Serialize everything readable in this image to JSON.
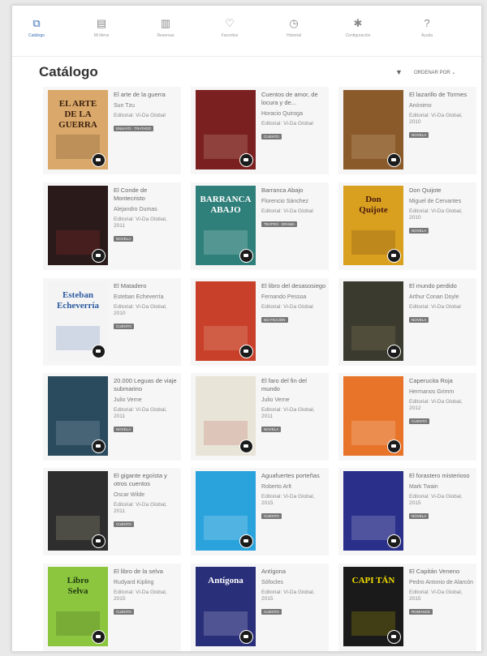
{
  "nav": [
    {
      "label": "Catálogo",
      "icon": "catalog-icon",
      "glyph": "⧉",
      "active": true
    },
    {
      "label": "Mi libros",
      "icon": "book-icon",
      "glyph": "▤",
      "active": false
    },
    {
      "label": "Reservas",
      "icon": "reservations-icon",
      "glyph": "▥",
      "active": false
    },
    {
      "label": "Favoritos",
      "icon": "heart-icon",
      "glyph": "♡",
      "active": false
    },
    {
      "label": "Historial",
      "icon": "history-icon",
      "glyph": "◷",
      "active": false
    },
    {
      "label": "Configuración",
      "icon": "gear-icon",
      "glyph": "✱",
      "active": false
    },
    {
      "label": "Ayuda",
      "icon": "help-icon",
      "glyph": "?",
      "active": false
    }
  ],
  "page": {
    "title": "Catálogo",
    "filter_icon": "filter-icon",
    "filter_glyph": "▼",
    "sort_label": "ORDENAR POR ⌄"
  },
  "books": [
    {
      "title": "El arte de la guerra",
      "author": "Sun Tzu",
      "publisher": "Editorial: Vi-Da Global",
      "tag": "ENSAYO · TRATADO",
      "cover": {
        "bg": "#d9a86a",
        "fg": "#3b1f0e",
        "text": "EL ARTE DE LA GUERRA"
      }
    },
    {
      "title": "Cuentos de amor, de locura y de...",
      "author": "Horacio Quiroga",
      "publisher": "Editorial: Vi-Da Global",
      "tag": "CUENTO",
      "cover": {
        "bg": "#7a2020",
        "fg": "#e8d9c0",
        "text": ""
      }
    },
    {
      "title": "El lazarillo de Tormes",
      "author": "Anónimo",
      "publisher": "Editorial: Vi-Da Global, 2010",
      "tag": "NOVELA",
      "cover": {
        "bg": "#8a5a2b",
        "fg": "#f0e0b0",
        "text": ""
      }
    },
    {
      "title": "El Conde de Montecristo",
      "author": "Alejandro Dumas",
      "publisher": "Editorial: Vi-Da Global, 2011",
      "tag": "NOVELA",
      "cover": {
        "bg": "#2a1a1a",
        "fg": "#c83030",
        "text": ""
      }
    },
    {
      "title": "Barranca Abajo",
      "author": "Florencio Sánchez",
      "publisher": "Editorial: Vi-Da Global",
      "tag": "TEATRO · DRAMA",
      "cover": {
        "bg": "#2f7f7a",
        "fg": "#ffffff",
        "text": "BARRANCA ABAJO"
      }
    },
    {
      "title": "Don Quijote",
      "author": "Miguel de Cervantes",
      "publisher": "Editorial: Vi-Da Global, 2010",
      "tag": "NOVELA",
      "cover": {
        "bg": "#d9a020",
        "fg": "#4a1a10",
        "text": "Don Quijote"
      }
    },
    {
      "title": "El Matadero",
      "author": "Esteban Echeverría",
      "publisher": "Editorial: Vi-Da Global, 2010",
      "tag": "CUENTO",
      "cover": {
        "bg": "#f4f4f4",
        "fg": "#2c5aa0",
        "text": "Esteban Echeverría"
      }
    },
    {
      "title": "El libro del desasosiego",
      "author": "Fernando Pessoa",
      "publisher": "Editorial: Vi-Da Global",
      "tag": "NO FICCIÓN",
      "cover": {
        "bg": "#c9402a",
        "fg": "#f4e6c8",
        "text": ""
      }
    },
    {
      "title": "El mundo perdido",
      "author": "Arthur Conan Doyle",
      "publisher": "Editorial: Vi-Da Global",
      "tag": "NOVELA",
      "cover": {
        "bg": "#3a3a2e",
        "fg": "#b5a77a",
        "text": ""
      }
    },
    {
      "title": "20.000 Leguas de viaje submarino",
      "author": "Julio Verne",
      "publisher": "Editorial: Vi-Da Global, 2011",
      "tag": "NOVELA",
      "cover": {
        "bg": "#2a4a5e",
        "fg": "#cfe0ea",
        "text": ""
      }
    },
    {
      "title": "El faro del fin del mundo",
      "author": "Julio Verne",
      "publisher": "Editorial: Vi-Da Global, 2011",
      "tag": "NOVELA",
      "cover": {
        "bg": "#e8e4d8",
        "fg": "#b03a2e",
        "text": ""
      }
    },
    {
      "title": "Caperucita Roja",
      "author": "Hermanos Grimm",
      "publisher": "Editorial: Vi-Da Global, 2012",
      "tag": "CUENTO",
      "cover": {
        "bg": "#e8742a",
        "fg": "#ffffff",
        "text": ""
      }
    },
    {
      "title": "El gigante egoísta y otros cuentos",
      "author": "Oscar Wilde",
      "publisher": "Editorial: Vi-Da Global, 2011",
      "tag": "CUENTO",
      "cover": {
        "bg": "#2e2e2e",
        "fg": "#e0d8b0",
        "text": ""
      }
    },
    {
      "title": "Aguafuertes porteñas",
      "author": "Roberto Arlt",
      "publisher": "Editorial: Vi-Da Global, 2015",
      "tag": "CUENTO",
      "cover": {
        "bg": "#2aa3dc",
        "fg": "#ffffff",
        "text": ""
      }
    },
    {
      "title": "El forastero misterioso",
      "author": "Mark Twain",
      "publisher": "Editorial: Vi-Da Global, 2015",
      "tag": "NOVELA",
      "cover": {
        "bg": "#2a2f8a",
        "fg": "#ffffff",
        "text": ""
      }
    },
    {
      "title": "El libro de la selva",
      "author": "Rudyard Kipling",
      "publisher": "Editorial: Vi-Da Global, 2015",
      "tag": "CUENTO",
      "cover": {
        "bg": "#8cc63f",
        "fg": "#1f3a10",
        "text": "Libro Selva"
      }
    },
    {
      "title": "Antígona",
      "author": "Sófocles",
      "publisher": "Editorial: Vi-Da Global, 2015",
      "tag": "CUENTO",
      "cover": {
        "bg": "#2a2f7a",
        "fg": "#ffffff",
        "text": "Antígona"
      }
    },
    {
      "title": "El Capitán Veneno",
      "author": "Pedro Antonio de Alarcón",
      "publisher": "Editorial: Vi-Da Global, 2015",
      "tag": "ROMANCE",
      "cover": {
        "bg": "#1a1a1a",
        "fg": "#f5e000",
        "text": "CAPI TÁN"
      }
    }
  ]
}
